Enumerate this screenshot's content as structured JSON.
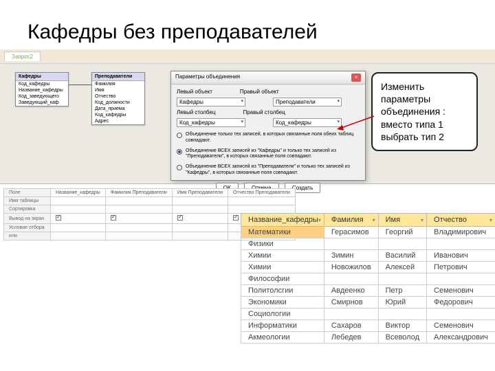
{
  "title": "Кафедры без преподавателей",
  "tab": "Запрос2",
  "designer": {
    "tables": [
      {
        "name": "Кафедры",
        "fields": [
          "Код_кафедры",
          "Название_кафедры",
          "Код_заведующего",
          "Заведующий_каф"
        ]
      },
      {
        "name": "Преподаватели",
        "fields": [
          "Фамилия",
          "Имя",
          "Отчество",
          "Код_должности",
          "Дата_приема",
          "Код_кафедры",
          "Адрес"
        ]
      }
    ]
  },
  "dialog": {
    "title": "Параметры объединения",
    "left_label": "Левый объект",
    "right_label": "Правый объект",
    "left_table": "Кафедры",
    "right_table": "Преподаватели",
    "left_col_lbl": "Левый столбец",
    "right_col_lbl": "Правый столбец",
    "left_col": "Код_кафедры",
    "right_col": "Код_кафедры",
    "opt1": "Объединение только тех записей, в которых связанные поля обеих таблиц совпадают.",
    "opt2": "Объединение ВСЕХ записей из \"Кафедры\" и только тех записей из \"Преподаватели\", в которых связанные поля совпадают.",
    "opt3": "Объединение ВСЕХ записей из \"Преподаватели\" и только тех записей из \"Кафедры\", в которых связанные поля совпадают.",
    "ok": "ОК",
    "cancel": "Отмена",
    "create": "Создать"
  },
  "callout": "Изменить параметры объединения : вместо типа 1 выбрать тип 2",
  "qgrid": {
    "rows": [
      "Поле",
      "Имя таблицы",
      "Сортировка",
      "Вывод на экран",
      "Условие отбора",
      "или"
    ],
    "cols": [
      [
        "Название_кафедры",
        "Фамилия Преподаватели",
        "Имя Преподаватели",
        "Отчество Преподаватели"
      ]
    ]
  },
  "result": {
    "headers": [
      "Название_кафедры",
      "Фамилия",
      "Имя",
      "Отчество"
    ],
    "rows": [
      [
        "Математики",
        "Герасимов",
        "Георгий",
        "Владимирович"
      ],
      [
        "Физики",
        "",
        "",
        ""
      ],
      [
        "Химии",
        "Зимин",
        "Василий",
        "Иванович"
      ],
      [
        "Химии",
        "Новожилов",
        "Алексей",
        "Петрович"
      ],
      [
        "Философии",
        "",
        "",
        ""
      ],
      [
        "Политолсгии",
        "Авдеенко",
        "Петр",
        "Семенович"
      ],
      [
        "Экономики",
        "Смирнов",
        "Юрий",
        "Федорович"
      ],
      [
        "Социологии",
        "",
        "",
        ""
      ],
      [
        "Информатики",
        "Сахаров",
        "Виктор",
        "Семенович"
      ],
      [
        "Акмеологии",
        "Лебедев",
        "Всеволод",
        "Александрович"
      ]
    ]
  }
}
